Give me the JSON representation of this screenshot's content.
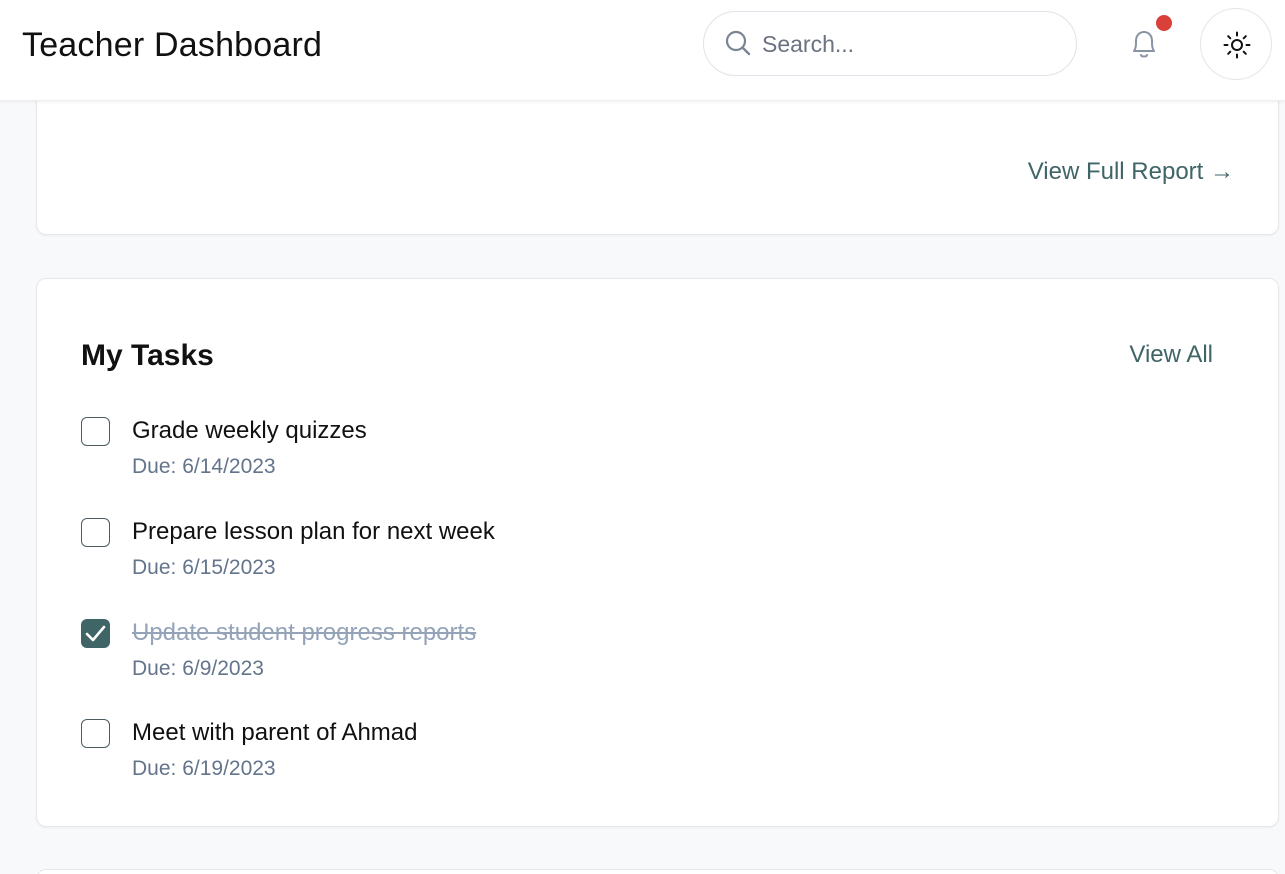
{
  "header": {
    "title": "Teacher Dashboard",
    "search_placeholder": "Search...",
    "notification_icon": "bell-icon",
    "theme_icon": "sun-icon"
  },
  "report_card": {
    "link_label": "View Full Report →"
  },
  "tasks_card": {
    "title": "My Tasks",
    "view_all_label": "View All",
    "items": [
      {
        "title": "Grade weekly quizzes",
        "due": "Due: 6/14/2023",
        "completed": false
      },
      {
        "title": "Prepare lesson plan for next week",
        "due": "Due: 6/15/2023",
        "completed": false
      },
      {
        "title": "Update student progress reports",
        "due": "Due: 6/9/2023",
        "completed": true
      },
      {
        "title": "Meet with parent of Ahmad",
        "due": "Due: 6/19/2023",
        "completed": false
      }
    ]
  },
  "colors": {
    "accent": "#3f6567",
    "notification_dot": "#d9403a",
    "background": "#f8f9fb"
  }
}
